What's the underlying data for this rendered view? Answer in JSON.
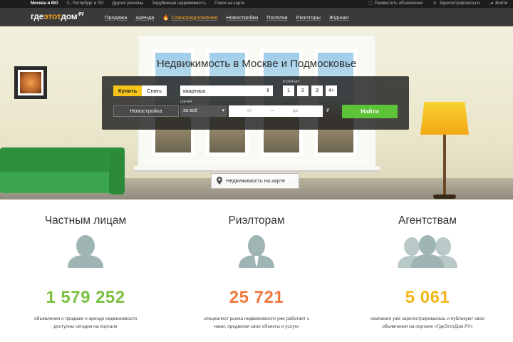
{
  "topbar": {
    "regions": [
      "Москва и МО",
      "С.-Петербург и ЛО",
      "Другие регионы",
      "Зарубежная недвижимость",
      "Поиск на карте"
    ],
    "actions": [
      "Разместить объявление",
      "Зарегистрироваться",
      "Войти"
    ]
  },
  "logo": {
    "a": "где",
    "b": "этот",
    "c": "дом",
    "d": ".ру"
  },
  "nav": {
    "items": [
      "Продажа",
      "Аренда",
      "Спецпредложения",
      "Новостройки",
      "Посёлки",
      "Риэлторы",
      "Журнал"
    ]
  },
  "hero": {
    "title": "Недвижимость в Москве и Подмосковье"
  },
  "search": {
    "buy": "Купить",
    "rent": "Снять",
    "property_type": "квартира",
    "rooms_label": "КОМНАТ",
    "rooms": [
      "1",
      "2",
      "3",
      "4+"
    ],
    "new_building": "Новостройка",
    "price_label": "ЦЕНА",
    "price_mode": "за всё",
    "price_from": "от",
    "price_dash": "—",
    "price_to": "до",
    "currency": "₽",
    "submit": "Найти"
  },
  "map_button": "Недвижимость на карте",
  "columns": [
    {
      "title": "Частным лицам",
      "number": "1 579 252",
      "color": "#7bc043",
      "desc": "объявления о продаже и аренде недвижимости доступны сегодня на портале"
    },
    {
      "title": "Риэлторам",
      "number": "25 721",
      "color": "#f07a3e",
      "desc": "специалист рынка недвижимости уже работает с нами, продвигая свои объекты и услуги"
    },
    {
      "title": "Агентствам",
      "number": "5 061",
      "color": "#f3b619",
      "desc": "компания уже зарегистрировалась и публикуют свои объявления на портале «ГдеЭтотДом.РУ»"
    }
  ]
}
